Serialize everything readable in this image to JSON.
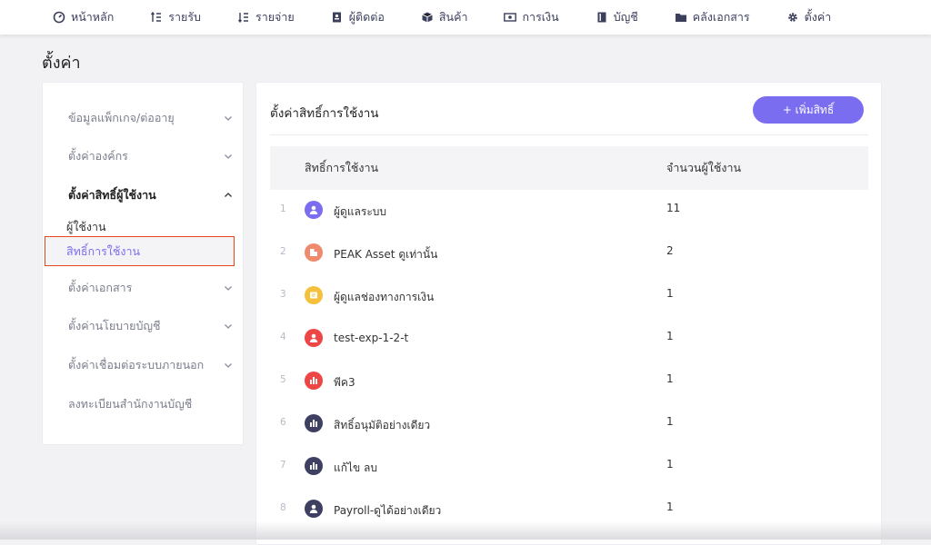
{
  "nav": {
    "items": [
      {
        "label": "หน้าหลัก",
        "icon": "dashboard-icon"
      },
      {
        "label": "รายรับ",
        "icon": "income-icon"
      },
      {
        "label": "รายจ่าย",
        "icon": "expense-icon"
      },
      {
        "label": "ผู้ติดต่อ",
        "icon": "contacts-icon"
      },
      {
        "label": "สินค้า",
        "icon": "box-icon"
      },
      {
        "label": "การเงิน",
        "icon": "money-icon"
      },
      {
        "label": "บัญชี",
        "icon": "book-icon"
      },
      {
        "label": "คลังเอกสาร",
        "icon": "folder-icon"
      },
      {
        "label": "ตั้งค่า",
        "icon": "gear-icon"
      }
    ]
  },
  "page": {
    "title": "ตั้งค่า"
  },
  "sidebar": {
    "items": [
      {
        "label": "ข้อมูลแพ็กเกจ/ต่ออายุ"
      },
      {
        "label": "ตั้งค่าองค์กร"
      },
      {
        "label": "ตั้งค่าสิทธิ์ผู้ใช้งาน"
      },
      {
        "label": "ตั้งค่าเอกสาร"
      },
      {
        "label": "ตั้งค่านโยบายบัญชี"
      },
      {
        "label": "ตั้งค่าเชื่อมต่อระบบภายนอก"
      },
      {
        "label": "ลงทะเบียนสำนักงานบัญชี"
      }
    ],
    "sub": {
      "users": "ผู้ใช้งาน",
      "permissions": "สิทธิ์การใช้งาน"
    }
  },
  "main": {
    "title": "ตั้งค่าสิทธิ์การใช้งาน",
    "add_button": "+ เพิ่มสิทธิ์",
    "columns": {
      "name": "สิทธิ์การใช้งาน",
      "count": "จำนวนผู้ใช้งาน"
    },
    "rows": [
      {
        "num": "1",
        "name": "ผู้ดูแลระบบ",
        "count": "11",
        "icon_color": "#7b6df0"
      },
      {
        "num": "2",
        "name": "PEAK Asset ดูเท่านั้น",
        "count": "2",
        "icon_color": "#f08a6c"
      },
      {
        "num": "3",
        "name": "ผู้ดูแลช่องทางการเงิน",
        "count": "1",
        "icon_color": "#f5c13d"
      },
      {
        "num": "4",
        "name": "test-exp-1-2-t",
        "count": "1",
        "icon_color": "#ee4545"
      },
      {
        "num": "5",
        "name": "พีค3",
        "count": "1",
        "icon_color": "#ee4545"
      },
      {
        "num": "6",
        "name": "สิทธิ์อนุมัติอย่างเดียว",
        "count": "1",
        "icon_color": "#3d4060"
      },
      {
        "num": "7",
        "name": "แก้ไข ลบ",
        "count": "1",
        "icon_color": "#3d4060"
      },
      {
        "num": "8",
        "name": "Payroll-ดูได้อย่างเดียว",
        "count": "1",
        "icon_color": "#3d4060"
      }
    ]
  }
}
